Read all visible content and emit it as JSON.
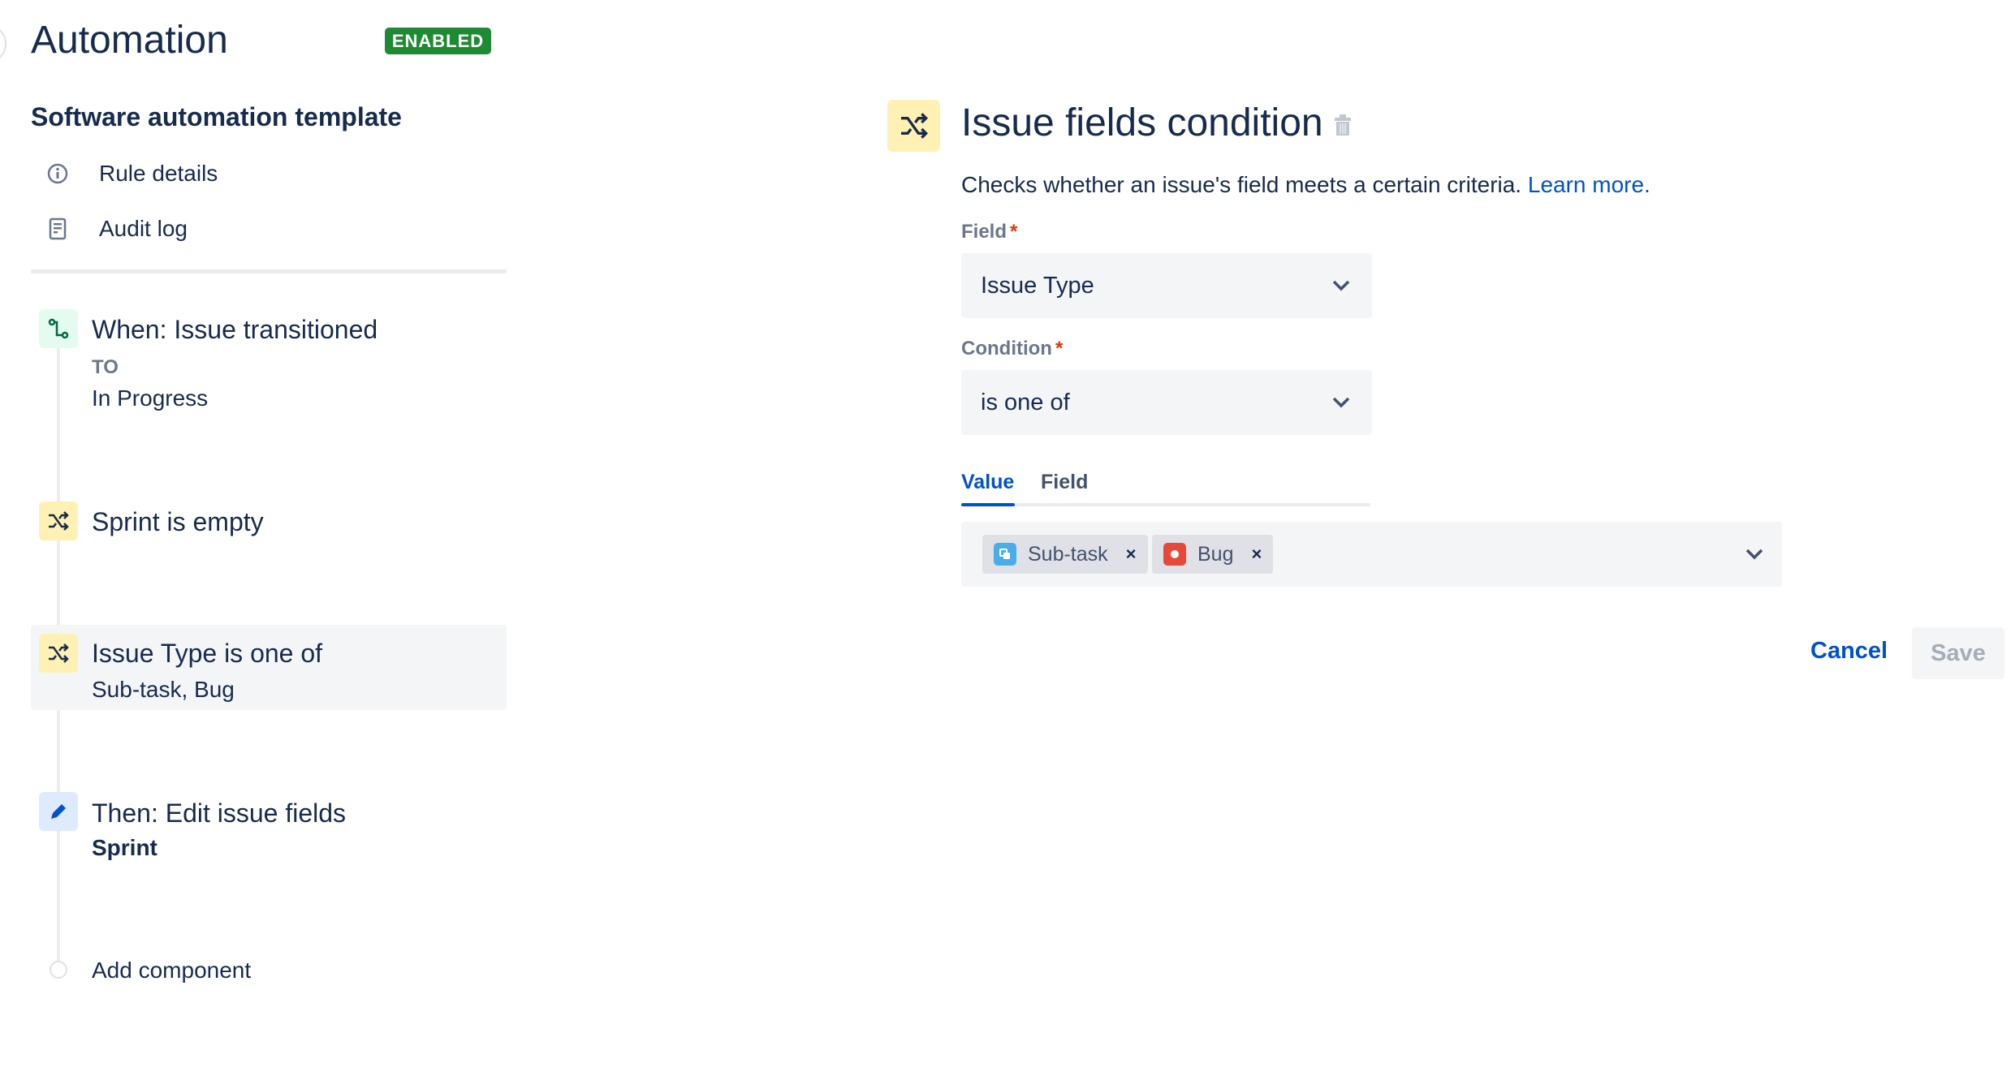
{
  "header": {
    "title": "Automation",
    "status_badge": "ENABLED",
    "badge_color": "#1f8a34"
  },
  "sidebar": {
    "rule_name": "Software automation template",
    "nav": [
      {
        "label": "Rule details",
        "icon": "info-icon"
      },
      {
        "label": "Audit log",
        "icon": "document-icon"
      }
    ],
    "steps": [
      {
        "title": "When: Issue transitioned",
        "kicker": "TO",
        "detail": "In Progress",
        "icon": "transition-icon"
      },
      {
        "title": "Sprint is empty",
        "icon": "shuffle-icon"
      },
      {
        "title": "Issue Type is one of",
        "detail": "Sub-task, Bug",
        "icon": "shuffle-icon",
        "selected": true
      },
      {
        "title": "Then: Edit issue fields",
        "detail": "Sprint",
        "icon": "pencil-icon"
      }
    ],
    "add_component": "Add component"
  },
  "panel": {
    "title": "Issue fields condition",
    "description": "Checks whether an issue's field meets a certain criteria.",
    "learn_more": "Learn more.",
    "field_label": "Field",
    "field_value": "Issue Type",
    "condition_label": "Condition",
    "condition_value": "is one of",
    "required_mark": "*",
    "tabs": [
      {
        "label": "Value",
        "active": true
      },
      {
        "label": "Field",
        "active": false
      }
    ],
    "values": [
      {
        "label": "Sub-task",
        "color": "#4bade8"
      },
      {
        "label": "Bug",
        "color": "#e5493a"
      }
    ],
    "remove_mark": "×",
    "cancel": "Cancel",
    "save": "Save"
  },
  "colors": {
    "accent": "#0052cc",
    "text": "#172b4d"
  }
}
